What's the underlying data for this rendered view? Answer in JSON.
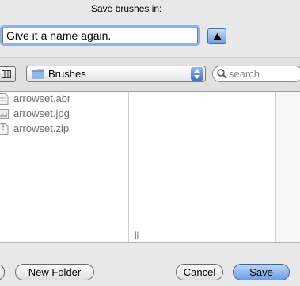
{
  "dialog": {
    "save_in_label": "Save brushes in:",
    "filename_value": "Give it a name again."
  },
  "toolbar": {
    "location_value": "Brushes",
    "search_placeholder": "search"
  },
  "files": [
    {
      "name": "arrowset.abr",
      "icon": "document-icon"
    },
    {
      "name": "arrowset.jpg",
      "icon": "image-file-icon"
    },
    {
      "name": "arrowset.zip",
      "icon": "zip-file-icon"
    }
  ],
  "buttons": {
    "new_folder": "New Folder",
    "cancel": "Cancel",
    "save": "Save"
  }
}
